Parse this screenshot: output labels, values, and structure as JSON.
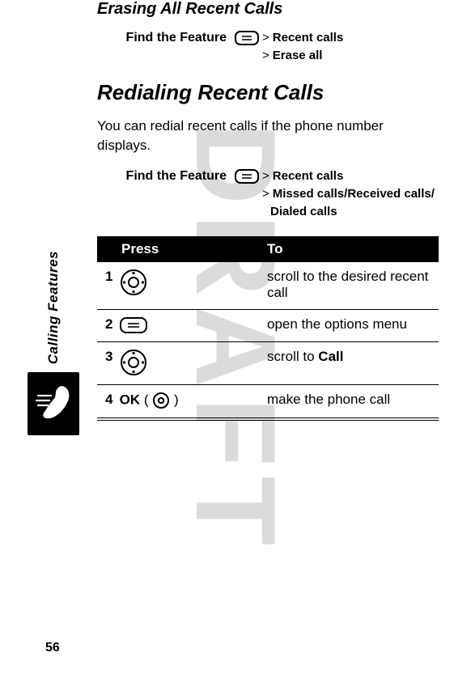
{
  "watermark": "DRAFT",
  "sidebar": {
    "label": "Calling Features"
  },
  "page_number": "56",
  "section1": {
    "title": "Erasing All Recent Calls",
    "find_label": "Find the Feature",
    "steps": [
      {
        "icon": "menu",
        "gt": ">",
        "text": "Recent calls"
      },
      {
        "gt": ">",
        "text": "Erase all"
      }
    ]
  },
  "section2": {
    "title": "Redialing Recent Calls",
    "body": "You can redial recent calls if the phone number displays.",
    "find_label": "Find the Feature",
    "steps": [
      {
        "icon": "menu",
        "gt": ">",
        "text": "Recent calls"
      },
      {
        "gt": ">",
        "text": "Missed calls/Received calls/"
      },
      {
        "text": "Dialed calls",
        "cont": true
      }
    ],
    "table": {
      "headers": {
        "press": "Press",
        "to": "To"
      },
      "rows": [
        {
          "n": "1",
          "press_icon": "nav",
          "to": "scroll to the desired recent call"
        },
        {
          "n": "2",
          "press_icon": "menu",
          "to": "open the options menu"
        },
        {
          "n": "3",
          "press_icon": "nav",
          "to_pre": "scroll to ",
          "to_bold": "Call"
        },
        {
          "n": "4",
          "press_text": "OK",
          "press_paren_icon": "select",
          "to": "make the phone call"
        }
      ]
    }
  }
}
